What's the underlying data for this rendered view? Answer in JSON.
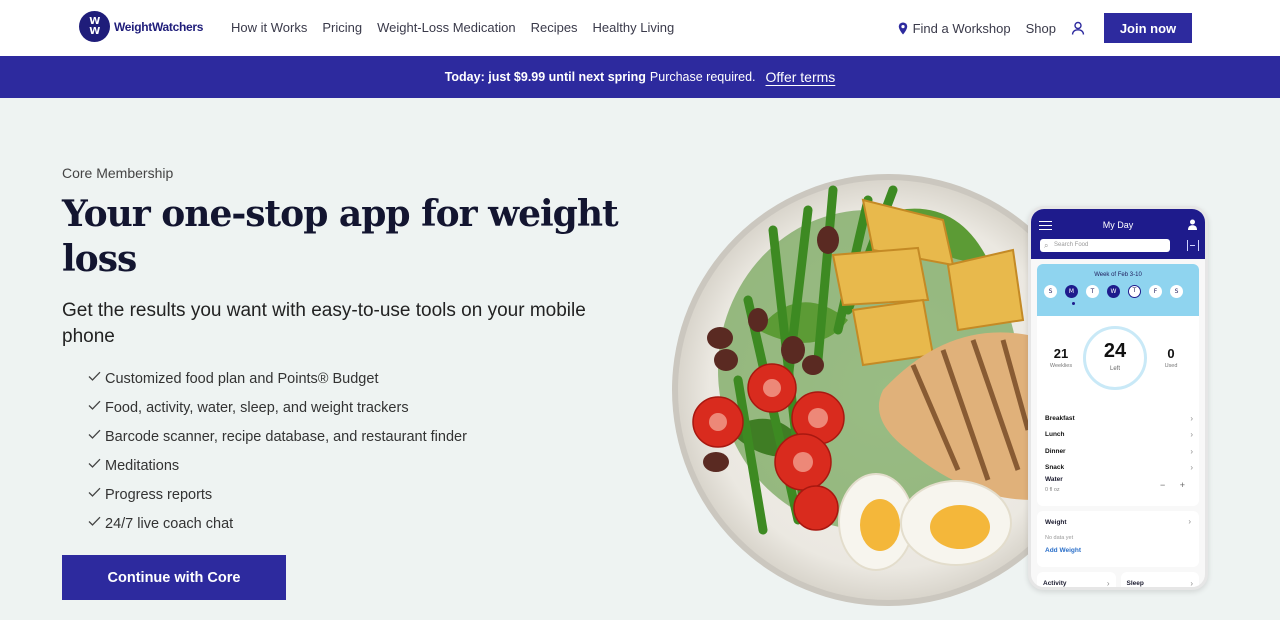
{
  "nav": {
    "logo_badge": [
      "W",
      "W"
    ],
    "logo_text": "WeightWatchers",
    "links": [
      "How it Works",
      "Pricing",
      "Weight-Loss Medication",
      "Recipes",
      "Healthy Living"
    ],
    "find_workshop": "Find a Workshop",
    "shop": "Shop",
    "join": "Join now"
  },
  "banner": {
    "bold": "Today: just $9.99 until next spring",
    "note": "Purchase required.",
    "offer_link": "Offer terms"
  },
  "hero": {
    "eyebrow": "Core Membership",
    "headline": "Your one-stop app for weight loss",
    "subheadline": "Get the results you want with easy-to-use tools on your mobile phone",
    "features": [
      "Customized food plan and Points® Budget",
      "Food, activity, water, sleep, and weight trackers",
      "Barcode scanner, recipe database, and restaurant finder",
      "Meditations",
      "Progress reports",
      "24/7 live coach chat"
    ],
    "cta": "Continue with Core"
  },
  "phone": {
    "title": "My Day",
    "search_placeholder": "Search Food",
    "week_label": "Week of Feb 3-10",
    "days": [
      "S",
      "M",
      "T",
      "W",
      "T",
      "F",
      "S"
    ],
    "weeklies_value": "21",
    "weeklies_label": "Weeklies",
    "left_value": "24",
    "left_label": "Left",
    "used_value": "0",
    "used_label": "Used",
    "meals": [
      "Breakfast",
      "Lunch",
      "Dinner",
      "Snack"
    ],
    "water_label": "Water",
    "water_value": "0 fl oz",
    "water_controls": "− +",
    "weight_label": "Weight",
    "weight_no_data": "No data yet",
    "weight_add": "Add Weight",
    "activity_label": "Activity",
    "sleep_label": "Sleep"
  },
  "colors": {
    "brand_indigo": "#2d2a9e",
    "hero_bg": "#eef3f2",
    "phone_header": "#1e1b8c",
    "calendar_bg": "#8fd4ef"
  }
}
